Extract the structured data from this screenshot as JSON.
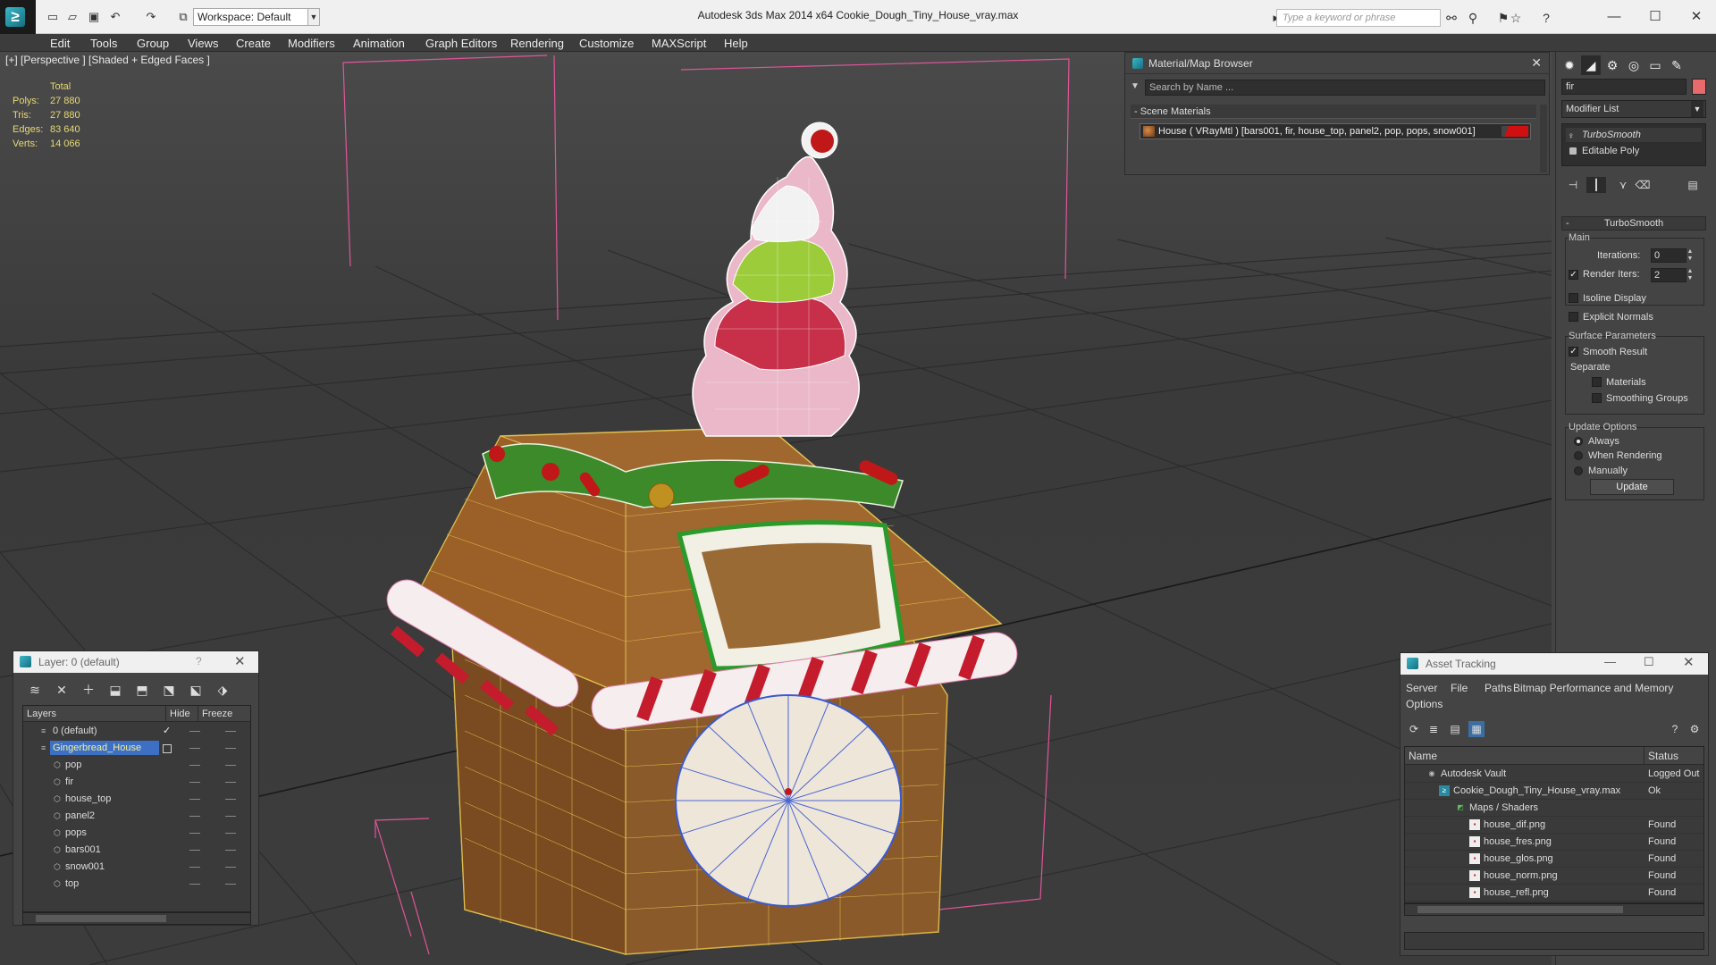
{
  "titlebar": {
    "workspace": "Workspace: Default",
    "title": "Autodesk 3ds Max  2014 x64      Cookie_Dough_Tiny_House_vray.max",
    "search_placeholder": "Type a keyword or phrase"
  },
  "menubar": [
    "Edit",
    "Tools",
    "Group",
    "Views",
    "Create",
    "Modifiers",
    "Animation",
    "Graph Editors",
    "Rendering",
    "Customize",
    "MAXScript",
    "Help"
  ],
  "viewport": {
    "label": "[+] [Perspective ] [Shaded + Edged Faces ]",
    "stats_header": "Total",
    "stats": [
      {
        "label": "Polys:",
        "value": "27 880"
      },
      {
        "label": "Tris:",
        "value": "27 880"
      },
      {
        "label": "Edges:",
        "value": "83 640"
      },
      {
        "label": "Verts:",
        "value": "14 066"
      }
    ]
  },
  "material_browser": {
    "title": "Material/Map Browser",
    "search": "Search by Name ...",
    "section": "- Scene Materials",
    "row": "House  ( VRayMtl )  [bars001, fir, house_top, panel2, pop, pops, snow001]"
  },
  "command_panel": {
    "object_name": "fir",
    "modifier_list": "Modifier List",
    "stack": [
      "TurboSmooth",
      "Editable Poly"
    ],
    "rollout": "TurboSmooth",
    "main_label": "Main",
    "iterations_label": "Iterations:",
    "iterations": "0",
    "render_iters_label": "Render Iters:",
    "render_iters": "2",
    "isoline": "Isoline Display",
    "explicit": "Explicit Normals",
    "surface_label": "Surface Parameters",
    "smooth": "Smooth Result",
    "separate": "Separate",
    "materials": "Materials",
    "smoothing_groups": "Smoothing Groups",
    "update_options": "Update Options",
    "always": "Always",
    "when_rendering": "When Rendering",
    "manually": "Manually",
    "update": "Update"
  },
  "layers": {
    "title": "Layer: 0 (default)",
    "help": "?",
    "col_layers": "Layers",
    "col_hide": "Hide",
    "col_freeze": "Freeze",
    "rows": [
      {
        "name": "0 (default)"
      },
      {
        "name": "Gingerbread_House"
      },
      {
        "name": "pop"
      },
      {
        "name": "fir"
      },
      {
        "name": "house_top"
      },
      {
        "name": "panel2"
      },
      {
        "name": "pops"
      },
      {
        "name": "bars001"
      },
      {
        "name": "snow001"
      },
      {
        "name": "top"
      }
    ]
  },
  "asset_tracking": {
    "title": "Asset Tracking",
    "menus": [
      "Server",
      "File",
      "Paths",
      "Bitmap Performance and Memory",
      "Options"
    ],
    "col_name": "Name",
    "col_status": "Status",
    "rows": [
      {
        "name": "Autodesk Vault",
        "status": "Logged Out"
      },
      {
        "name": "Cookie_Dough_Tiny_House_vray.max",
        "status": "Ok"
      },
      {
        "name": "Maps / Shaders",
        "status": ""
      },
      {
        "name": "house_dif.png",
        "status": "Found"
      },
      {
        "name": "house_fres.png",
        "status": "Found"
      },
      {
        "name": "house_glos.png",
        "status": "Found"
      },
      {
        "name": "house_norm.png",
        "status": "Found"
      },
      {
        "name": "house_refl.png",
        "status": "Found"
      }
    ]
  }
}
